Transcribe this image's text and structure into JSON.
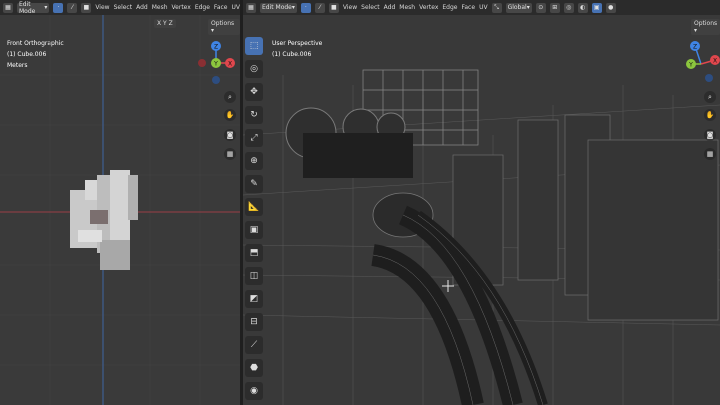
{
  "left_header": {
    "mode_label": "Edit Mode",
    "menu": [
      "View",
      "Select",
      "Add",
      "Mesh",
      "Vertex",
      "Edge",
      "Face",
      "UV"
    ],
    "axes": [
      "X",
      "Y",
      "Z"
    ],
    "options_label": "Options"
  },
  "right_header": {
    "mode_label": "Edit Mode",
    "menu": [
      "View",
      "Select",
      "Add",
      "Mesh",
      "Vertex",
      "Edge",
      "Face",
      "UV"
    ],
    "orientation_label": "Global",
    "options_label": "Options"
  },
  "left_viewport": {
    "view_name": "Front Orthographic",
    "object_name": "(1) Cube.006",
    "units": "Meters",
    "gizmo": {
      "z": "Z",
      "y": "Y",
      "x": "X"
    }
  },
  "right_viewport": {
    "view_name": "User Perspective",
    "object_name": "(1) Cube.006",
    "gizmo": {
      "z": "Z",
      "y": "Y",
      "x": "X"
    }
  },
  "tools": [
    "select-box-icon",
    "cursor-icon",
    "move-icon",
    "rotate-icon",
    "scale-icon",
    "transform-icon",
    "annotate-icon",
    "measure-icon",
    "add-cube-icon",
    "extrude-icon",
    "inset-icon",
    "bevel-icon",
    "loop-cut-icon",
    "knife-icon",
    "poly-build-icon",
    "spin-icon"
  ],
  "colors": {
    "accent": "#4772b3",
    "x_axis": "#e0474d",
    "y_axis": "#8cc63e",
    "z_axis": "#3f84e5",
    "header_bg": "#2b2b2b"
  }
}
